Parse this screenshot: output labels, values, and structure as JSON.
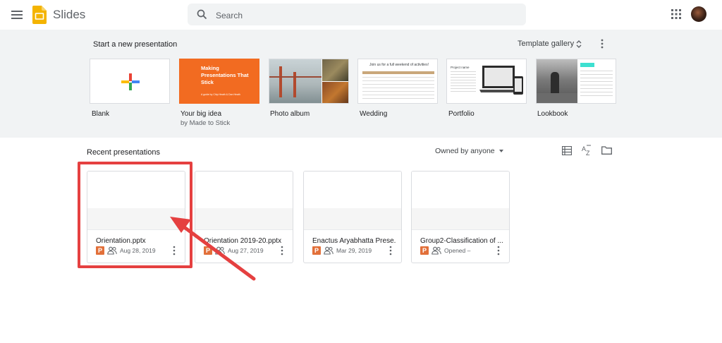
{
  "header": {
    "app_name": "Slides",
    "search_placeholder": "Search",
    "logo_color": "#F4B400"
  },
  "templates_section": {
    "title": "Start a new presentation",
    "gallery_label": "Template gallery",
    "items": [
      {
        "label": "Blank",
        "subtitle": ""
      },
      {
        "label": "Your big idea",
        "subtitle": "by Made to Stick",
        "thumb_text": "Making Presentations That Stick",
        "thumb_subtext": "A guide by Chip Heath & Dan Heath"
      },
      {
        "label": "Photo album",
        "subtitle": ""
      },
      {
        "label": "Wedding",
        "subtitle": "",
        "thumb_text": "Join us for a full weekend of activities!"
      },
      {
        "label": "Portfolio",
        "subtitle": "",
        "thumb_text": "Project name"
      },
      {
        "label": "Lookbook",
        "subtitle": ""
      }
    ]
  },
  "recent_section": {
    "title": "Recent presentations",
    "owner_filter": "Owned by anyone",
    "files": [
      {
        "name": "Orientation.pptx",
        "date": "Aug 28, 2019",
        "type_badge": "P"
      },
      {
        "name": "Orientation 2019-20.pptx",
        "date": "Aug 27, 2019",
        "type_badge": "P"
      },
      {
        "name": "Enactus Aryabhatta Prese...",
        "date": "Mar 29, 2019",
        "type_badge": "P"
      },
      {
        "name": "Group2-Classification of ...",
        "date": "Opened –",
        "type_badge": "P"
      }
    ]
  },
  "colors": {
    "accent_orange": "#E2703A",
    "highlight_red": "#E54040",
    "band_gray": "#F1F3F4"
  }
}
